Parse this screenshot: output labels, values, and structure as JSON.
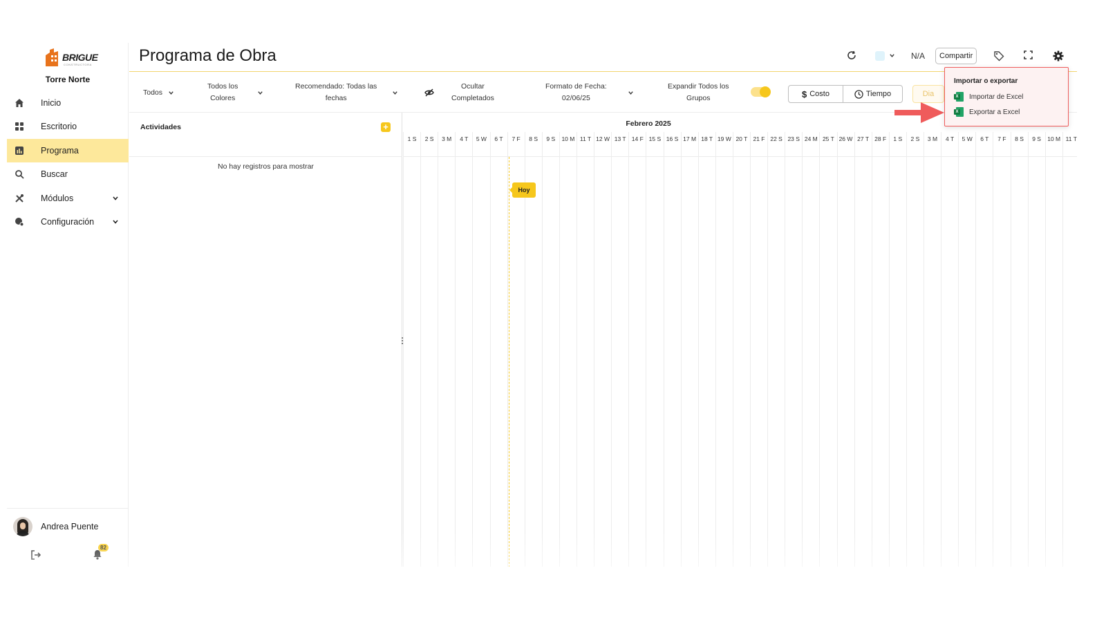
{
  "brand": {
    "logo_text": "BRIGUE",
    "logo_sub": "CONSTRUCTORA",
    "project": "Torre Norte"
  },
  "sidebar": {
    "items": [
      {
        "label": "Inicio",
        "icon": "home-icon"
      },
      {
        "label": "Escritorio",
        "icon": "grid-icon"
      },
      {
        "label": "Programa",
        "icon": "chart-icon",
        "active": true
      },
      {
        "label": "Buscar",
        "icon": "search-icon"
      },
      {
        "label": "Módulos",
        "icon": "tools-icon",
        "expandable": true
      },
      {
        "label": "Configuración",
        "icon": "settings-user-icon",
        "expandable": true
      }
    ],
    "user": {
      "name": "Andrea Puente"
    },
    "notifications_count": "82"
  },
  "header": {
    "title": "Programa de Obra",
    "na_label": "N/A",
    "share_label": "Compartir"
  },
  "toolbar": {
    "filter_all": "Todos",
    "colors_line1": "Todos los",
    "colors_line2": "Colores",
    "recommended_line1": "Recomendado: Todas las",
    "recommended_line2": "fechas",
    "hide_line1": "Ocultar",
    "hide_line2": "Completados",
    "date_format_line1": "Formato de Fecha:",
    "date_format_line2": "02/06/25",
    "expand_line1": "Expandir Todos los",
    "expand_line2": "Grupos",
    "expand_on": true,
    "cost_label": "Costo",
    "time_label": "Tiempo",
    "day_label": "Dia"
  },
  "activities": {
    "title": "Actividades",
    "empty_message": "No hay registros para mostrar"
  },
  "gantt": {
    "month": "Febrero 2025",
    "days": [
      "1 S",
      "2 S",
      "3 M",
      "4 T",
      "5 W",
      "6 T",
      "7 F",
      "8 S",
      "9 S",
      "10 M",
      "11 T",
      "12 W",
      "13 T",
      "14 F",
      "15 S",
      "16 S",
      "17 M",
      "18 T",
      "19 W",
      "20 T",
      "21 F",
      "22 S",
      "23 S",
      "24 M",
      "25 T",
      "26 W",
      "27 T",
      "28 F",
      "1 S",
      "2 S",
      "3 M",
      "4 T",
      "5 W",
      "6 T",
      "7 F",
      "8 S",
      "9 S",
      "10 M",
      "11 T"
    ],
    "today_label": "Hoy"
  },
  "popup": {
    "title": "Importar o exportar",
    "import_label": "Importar de Excel",
    "export_label": "Exportar a Excel"
  },
  "colors": {
    "accent": "#f6c71c",
    "active_nav": "#fde89b",
    "popup_border": "#ef5b5b",
    "arrow": "#ef5b5b"
  }
}
